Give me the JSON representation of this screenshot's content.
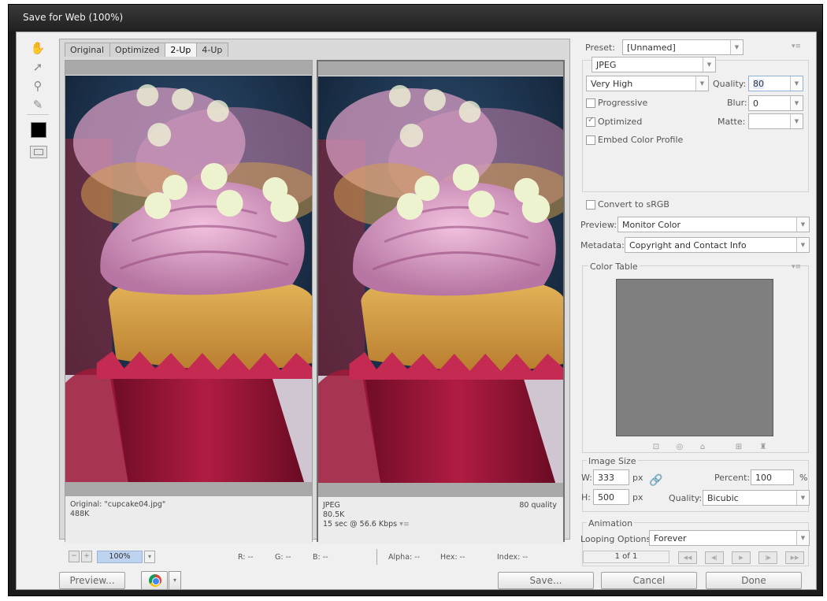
{
  "window": {
    "title": "Save for Web (100%)"
  },
  "tools": {
    "hand": "hand-icon",
    "slice": "slice-select-icon",
    "zoom": "zoom-icon",
    "eyedropper": "eyedropper-icon"
  },
  "view_tabs": [
    "Original",
    "Optimized",
    "2-Up",
    "4-Up"
  ],
  "active_tab": "2-Up",
  "panes": {
    "left": {
      "line1": "Original: \"cupcake04.jpg\"",
      "line2": "488K"
    },
    "right": {
      "format": "JPEG",
      "quality": "80 quality",
      "size": "80.5K",
      "download": "15 sec @ 56.6 Kbps"
    }
  },
  "zoombar": {
    "zoom": "100%",
    "r": "R: --",
    "g": "G: --",
    "b": "B: --",
    "alpha": "Alpha: --",
    "hex": "Hex: --",
    "index": "Index: --"
  },
  "bottom": {
    "preview": "Preview...",
    "save": "Save...",
    "cancel": "Cancel",
    "done": "Done"
  },
  "settings": {
    "preset_label": "Preset:",
    "preset": "[Unnamed]",
    "format": "JPEG",
    "compression": "Very High",
    "quality_label": "Quality:",
    "quality": "80",
    "progressive": "Progressive",
    "blur_label": "Blur:",
    "blur": "0",
    "optimized": "Optimized",
    "matte_label": "Matte:",
    "embed_profile": "Embed Color Profile",
    "convert_srgb": "Convert to sRGB",
    "preview_label": "Preview:",
    "preview_value": "Monitor Color",
    "metadata_label": "Metadata:",
    "metadata_value": "Copyright and Contact Info"
  },
  "checkboxes": {
    "progressive": false,
    "optimized": true,
    "embed_profile": false,
    "convert_srgb": false
  },
  "color_table": {
    "title": "Color Table"
  },
  "image_size": {
    "title": "Image Size",
    "w_label": "W:",
    "w": "333",
    "h_label": "H:",
    "h": "500",
    "unit": "px",
    "percent_label": "Percent:",
    "percent": "100",
    "percent_unit": "%",
    "quality_label": "Quality:",
    "quality": "Bicubic"
  },
  "animation": {
    "title": "Animation",
    "looping_label": "Looping Options:",
    "looping": "Forever",
    "frame": "1 of 1"
  },
  "colors": {
    "zoom_field": "#bed3f0",
    "title_bar": "#202020",
    "color_table_well": "#7f7f7f"
  }
}
